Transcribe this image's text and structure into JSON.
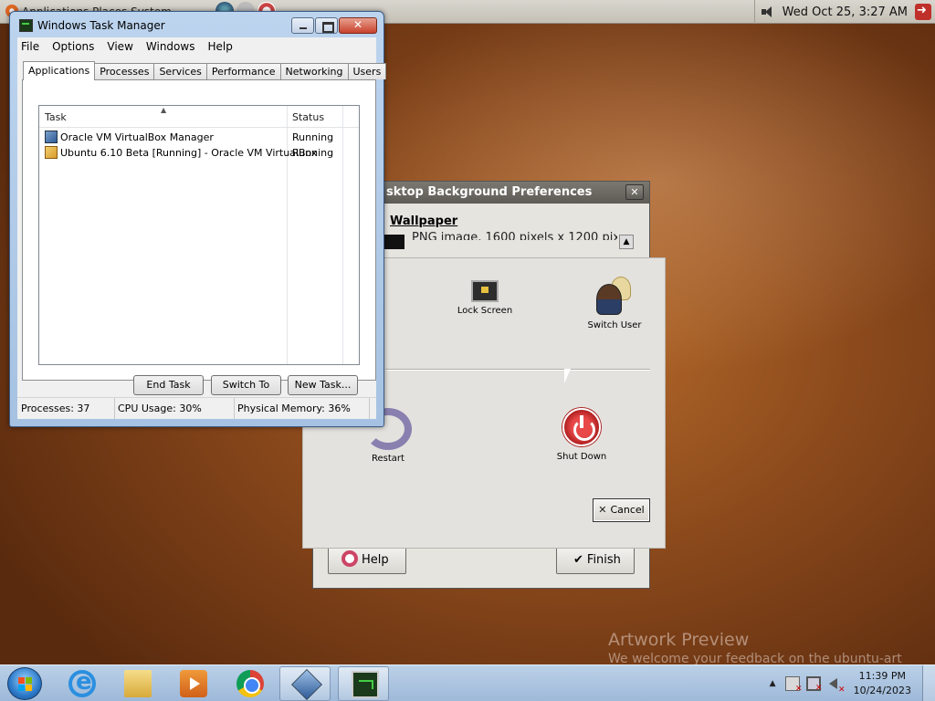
{
  "top_panel": {
    "apps_menu": "Applications  Places  System",
    "clock": "Wed Oct 25,  3:27 AM"
  },
  "task_manager": {
    "title": "Windows Task Manager",
    "menu": [
      "File",
      "Options",
      "View",
      "Windows",
      "Help"
    ],
    "tabs": [
      "Applications",
      "Processes",
      "Services",
      "Performance",
      "Networking",
      "Users"
    ],
    "active_tab": "Applications",
    "columns": {
      "task": "Task",
      "status": "Status"
    },
    "rows": [
      {
        "task": "Oracle VM VirtualBox Manager",
        "status": "Running",
        "icon": "virtualbox-icon"
      },
      {
        "task": "Ubuntu 6.10 Beta [Running] - Oracle VM VirtualBox",
        "status": "Running",
        "icon": "vm-window-icon"
      }
    ],
    "buttons": {
      "end_task": "End Task",
      "switch_to": "Switch To",
      "new_task": "New Task..."
    },
    "status_bar": {
      "processes": "Processes: 37",
      "cpu": "CPU Usage: 30%",
      "memory": "Physical Memory: 36%"
    }
  },
  "bg_prefs": {
    "title": "sktop Background Preferences",
    "wallpaper_label": "Wallpaper",
    "image_info": "PNG image, 1600 pixels x 1200 pix",
    "help_label": "Help",
    "finish_label": "Finish"
  },
  "logout_dialog": {
    "lock_screen": "Lock Screen",
    "switch_user": "Switch User",
    "restart": "Restart",
    "shut_down": "Shut Down",
    "cancel": "Cancel"
  },
  "watermark": {
    "title": "Artwork Preview",
    "subtitle": "We welcome your feedback on the ubuntu-art"
  },
  "taskbar": {
    "apps": [
      "internet-explorer-icon",
      "file-explorer-icon",
      "media-player-icon",
      "chrome-icon",
      "virtualbox-icon",
      "task-manager-icon"
    ],
    "clock_time": "11:39 PM",
    "clock_date": "10/24/2023"
  },
  "colors": {
    "taskbar": "#a6c2e2",
    "window_frame": "#bcd4ee",
    "desktop": "#8c4a1c"
  }
}
